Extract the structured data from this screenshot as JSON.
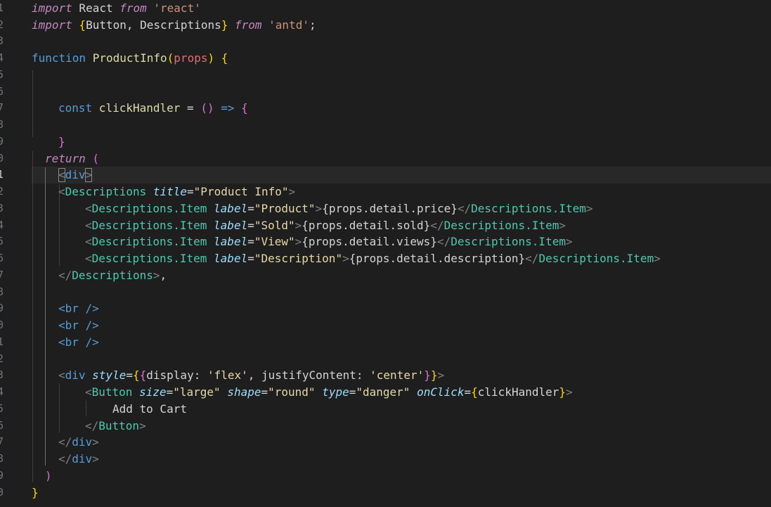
{
  "editor": {
    "language": "JavaScript React",
    "active_line": "1",
    "line_numbers": [
      "1",
      "2",
      "3",
      "4",
      "5",
      "6",
      "7",
      "8",
      "9",
      "0",
      "1",
      "2",
      "3",
      "4",
      "5",
      "6",
      "7",
      "8",
      "9",
      "0",
      "1",
      "2",
      "3",
      "4",
      "5",
      "6",
      "7",
      "8",
      "9",
      "0"
    ],
    "code": {
      "l1": {
        "import": "import",
        "react_name": " React ",
        "from": "from",
        "module": " 'react'"
      },
      "l2": {
        "import": "import",
        "brace_open": " {",
        "names": "Button, Descriptions",
        "brace_close": "}",
        "from": " from",
        "module": " 'antd'",
        "semi": ";"
      },
      "l4": {
        "function": "function",
        "name": " ProductInfo",
        "paren_open": "(",
        "param": "props",
        "paren_close": ")",
        "brace": " {"
      },
      "l7": {
        "const": "const",
        "name": " clickHandler",
        "eq": " = ",
        "parens": "()",
        "arrow": " => ",
        "brace": "{"
      },
      "l9": {
        "brace": "}"
      },
      "l10": {
        "return": "return",
        "paren": " ("
      },
      "l11": {
        "lt": "<",
        "tag": "div",
        "gt": ">"
      },
      "l12": {
        "lt": "<",
        "tag": "Descriptions",
        "attr": " title",
        "eq": "=",
        "value": "\"Product Info\"",
        "gt": ">"
      },
      "l13": {
        "lt": "<",
        "tag": "Descriptions.Item",
        "attr": " label",
        "eq": "=",
        "value": "\"Product\"",
        "gt": ">",
        "expr": "{props.detail.price}",
        "close_lt": "</",
        "close_tag": "Descriptions.Item",
        "close_gt": ">"
      },
      "l14": {
        "lt": "<",
        "tag": "Descriptions.Item",
        "attr": " label",
        "eq": "=",
        "value": "\"Sold\"",
        "gt": ">",
        "expr": "{props.detail.sold}",
        "close_lt": "</",
        "close_tag": "Descriptions.Item",
        "close_gt": ">"
      },
      "l15": {
        "lt": "<",
        "tag": "Descriptions.Item",
        "attr": " label",
        "eq": "=",
        "value": "\"View\"",
        "gt": ">",
        "expr": "{props.detail.views}",
        "close_lt": "</",
        "close_tag": "Descriptions.Item",
        "close_gt": ">"
      },
      "l16": {
        "lt": "<",
        "tag": "Descriptions.Item",
        "attr": " label",
        "eq": "=",
        "value": "\"Description\"",
        "gt": ">",
        "expr": "{props.detail.description}",
        "close_lt": "</",
        "close_tag": "Descriptions.Item",
        "close_gt": ">"
      },
      "l17": {
        "lt": "</",
        "tag": "Descriptions",
        "gt": ">",
        "comma": ","
      },
      "l19": {
        "text": "<br />"
      },
      "l20": {
        "text": "<br />"
      },
      "l21": {
        "text": "<br />"
      },
      "l23": {
        "lt": "<",
        "tag": "div",
        "attr": " style",
        "eq": "=",
        "b_outer": "{",
        "b_inner": "{",
        "body1": "display: ",
        "s1": "'flex'",
        "body2": ", justifyContent: ",
        "s2": "'center'",
        "b_inner_close": "}",
        "b_outer_close": "}",
        "gt": ">"
      },
      "l24": {
        "lt": "<",
        "tag": "Button",
        "a1": " size",
        "eq1": "=",
        "v1": "\"large\"",
        "a2": " shape",
        "eq2": "=",
        "v2": "\"round\"",
        "a3": " type",
        "eq3": "=",
        "v3": "\"danger\"",
        "a4": " onClick",
        "eq4": "=",
        "ob": "{",
        "handler": "clickHandler",
        "cb": "}",
        "gt": ">"
      },
      "l25": {
        "text": "Add to Cart"
      },
      "l26": {
        "lt": "</",
        "tag": "Button",
        "gt": ">"
      },
      "l27": {
        "lt": "</",
        "tag": "div",
        "gt": ">"
      },
      "l28": {
        "lt": "</",
        "tag": "div",
        "gt": ">"
      },
      "l29": {
        "paren": ")"
      },
      "l30": {
        "brace": "}"
      }
    }
  }
}
